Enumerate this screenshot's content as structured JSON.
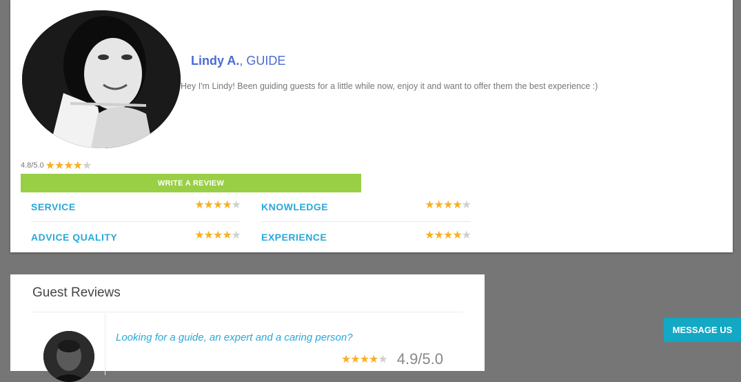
{
  "profile": {
    "name": "Lindy A.",
    "role_suffix": ", GUIDE",
    "bio": "Hey I'm Lindy! Been guiding guests for a little while now, enjoy it and want to offer them the best experience :)",
    "overall_score": "4.8/5.0",
    "overall_stars": 4,
    "write_review_label": "WRITE A REVIEW",
    "ratings": [
      {
        "label": "SERVICE",
        "stars": 4
      },
      {
        "label": "ADVICE QUALITY",
        "stars": 4
      },
      {
        "label": "KNOWLEDGE",
        "stars": 4
      },
      {
        "label": "EXPERIENCE",
        "stars": 4
      }
    ]
  },
  "reviews": {
    "title": "Guest Reviews",
    "items": [
      {
        "headline": "Looking for a guide, an expert and a caring person?",
        "stars": 4,
        "score": "4.9/5.0"
      }
    ]
  },
  "chat": {
    "label": "MESSAGE US"
  },
  "colors": {
    "accent_blue": "#29a8d8",
    "name_blue": "#4a6bd4",
    "review_green": "#99cf45",
    "star_gold": "#f7b024",
    "chat_teal": "#13a8c4"
  },
  "icons": {
    "star": "star-icon"
  }
}
